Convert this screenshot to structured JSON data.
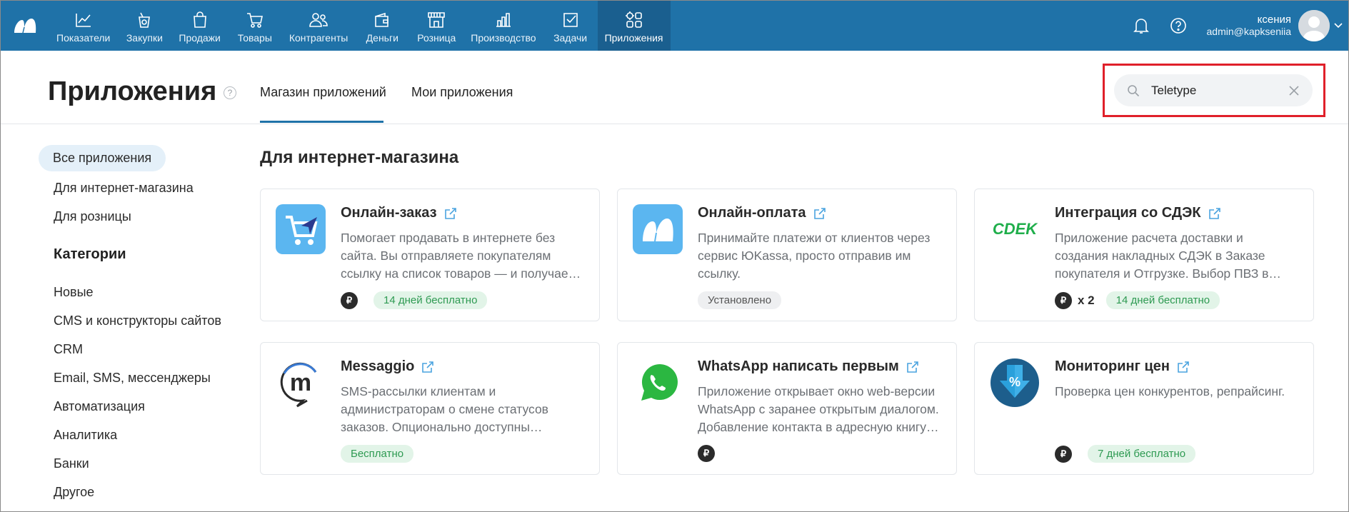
{
  "nav": {
    "items": [
      {
        "label": "Показатели",
        "icon": "chart-icon"
      },
      {
        "label": "Закупки",
        "icon": "shopping-bag-icon"
      },
      {
        "label": "Продажи",
        "icon": "bag-icon"
      },
      {
        "label": "Товары",
        "icon": "cart-icon"
      },
      {
        "label": "Контрагенты",
        "icon": "people-icon"
      },
      {
        "label": "Деньги",
        "icon": "wallet-icon"
      },
      {
        "label": "Розница",
        "icon": "store-icon"
      },
      {
        "label": "Производство",
        "icon": "factory-icon"
      },
      {
        "label": "Задачи",
        "icon": "tasks-icon"
      },
      {
        "label": "Приложения",
        "icon": "apps-icon",
        "active": true
      }
    ],
    "user_name": "ксения",
    "user_email": "admin@kapkseniia"
  },
  "header": {
    "title": "Приложения",
    "help": "?",
    "tabs": [
      {
        "label": "Магазин приложений",
        "active": true
      },
      {
        "label": "Мои приложения",
        "active": false
      }
    ],
    "search": {
      "value": "Teletype",
      "placeholder": ""
    }
  },
  "sidebar": {
    "top_items": [
      "Все приложения",
      "Для интернет-магазина",
      "Для розницы"
    ],
    "categories_title": "Категории",
    "categories": [
      "Новые",
      "CMS и конструкторы сайтов",
      "CRM",
      "Email, SMS, мессенджеры",
      "Автоматизация",
      "Аналитика",
      "Банки",
      "Другое"
    ]
  },
  "main": {
    "section_title": "Для интернет-магазина",
    "cards": [
      {
        "title": "Онлайн-заказ",
        "desc": [
          "Помогает продавать в интернете без",
          "сайта. Вы отправляете покупателям",
          "ссылку на список товаров — и получае…"
        ],
        "rub": "₽",
        "mult": "",
        "badge": "14 дней бесплатно",
        "badge_style": "green",
        "icon": "online-order-icon"
      },
      {
        "title": "Онлайн-оплата",
        "desc": [
          "Принимайте платежи от клиентов через",
          "сервис ЮKassa, просто отправив им",
          "ссылку."
        ],
        "rub": "",
        "mult": "",
        "badge": "Установлено",
        "badge_style": "gray",
        "icon": "online-payment-icon"
      },
      {
        "title": "Интеграция со СДЭК",
        "desc": [
          "Приложение расчета доставки и",
          "создания накладных СДЭК в Заказе",
          "покупателя и Отгрузке. Выбор ПВЗ в…"
        ],
        "rub": "₽",
        "mult": "x 2",
        "badge": "14 дней бесплатно",
        "badge_style": "green",
        "icon": "cdek-logo-icon",
        "logo_text": "СDEK"
      },
      {
        "title": "Messaggio",
        "desc": [
          "SMS-рассылки клиентам и",
          "администраторам о смене статусов",
          "заказов. Опционально доступны…"
        ],
        "rub": "",
        "mult": "",
        "badge": "Бесплатно",
        "badge_style": "green",
        "icon": "messaggio-logo-icon",
        "logo_text": "m"
      },
      {
        "title": "WhatsApp написать первым",
        "desc": [
          "Приложение открывает окно web-версии",
          "WhatsApp с заранее открытым диалогом.",
          "Добавление контакта в адресную книгу…"
        ],
        "rub": "₽",
        "mult": "",
        "badge": "",
        "badge_style": "",
        "icon": "whatsapp-icon"
      },
      {
        "title": "Мониторинг цен",
        "desc": [
          "Проверка цен конкурентов, репрайсинг."
        ],
        "rub": "₽",
        "mult": "",
        "badge": "7 дней бесплатно",
        "badge_style": "green",
        "icon": "price-monitoring-icon",
        "logo_text": "%"
      }
    ]
  }
}
